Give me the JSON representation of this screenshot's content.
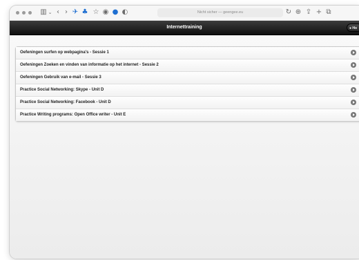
{
  "browser": {
    "url_text": "Nicht sicher — geengee.eu"
  },
  "app": {
    "title": "Internettraining",
    "home_button_label": "Ho"
  },
  "items": [
    {
      "label": "Oefeningen surfen op webpagina's - Sessie 1"
    },
    {
      "label": "Oefeningen Zoeken en vinden van informatie op het internet - Sessie 2"
    },
    {
      "label": "Oefeningen Gebruik van e-mail - Sessie 3"
    },
    {
      "label": "Practice Social Networking: Skype - Unit D"
    },
    {
      "label": "Practice Social Networking: Facebook - Unit D"
    },
    {
      "label": "Practice Writing programs: Open Office writer - Unit E"
    }
  ],
  "colors": {
    "header_bg": "#1c1c1c",
    "accent_blue": "#1f6fd1"
  }
}
